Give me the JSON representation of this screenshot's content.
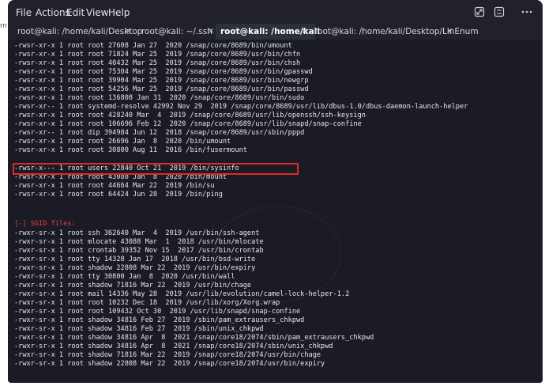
{
  "menubar": {
    "items": [
      "File",
      "Actions",
      "Edit",
      "View",
      "Help"
    ],
    "controls": {
      "maximize": "expand-icon",
      "split": "split-icon",
      "more": "more-icon"
    }
  },
  "tabs": [
    {
      "label": "root@kali: /home/kali/Desktop",
      "close": "×"
    },
    {
      "label": "root@kali: ~/.ssh",
      "close": "×"
    },
    {
      "label": "root@kali: /home/kali",
      "close": "×",
      "active": true
    },
    {
      "label": "root@kali: /home/kali/Desktop/LinEnum",
      "close": "×"
    }
  ],
  "terminal": {
    "suid_lines": [
      "-rwsr-xr-x 1 root root 27608 Jan 27  2020 /snap/core/8689/bin/umount",
      "-rwsr-xr-x 1 root root 71824 Mar 25  2019 /snap/core/8689/usr/bin/chfn",
      "-rwsr-xr-x 1 root root 40432 Mar 25  2019 /snap/core/8689/usr/bin/chsh",
      "-rwsr-xr-x 1 root root 75304 Mar 25  2019 /snap/core/8689/usr/bin/gpasswd",
      "-rwsr-xr-x 1 root root 39904 Mar 25  2019 /snap/core/8689/usr/bin/newgrp",
      "-rwsr-xr-x 1 root root 54256 Mar 25  2019 /snap/core/8689/usr/bin/passwd",
      "-rwsr-xr-x 1 root root 136808 Jan 31  2020 /snap/core/8689/usr/bin/sudo",
      "-rwsr-xr-- 1 root systemd-resolve 42992 Nov 29  2019 /snap/core/8689/usr/lib/dbus-1.0/dbus-daemon-launch-helper",
      "-rwsr-xr-x 1 root root 428240 Mar  4  2019 /snap/core/8689/usr/lib/openssh/ssh-keysign",
      "-rwsr-xr-x 1 root root 106696 Feb 12  2020 /snap/core/8689/usr/lib/snapd/snap-confine",
      "-rwsr-xr-- 1 root dip 394984 Jun 12  2018 /snap/core/8689/usr/sbin/pppd",
      "-rwsr-xr-x 1 root root 26696 Jan  8  2020 /bin/umount",
      "-rwsr-xr-x 1 root root 30800 Aug 11  2016 /bin/fusermount",
      "-rwsr-x--- 1 root users 22840 Oct 21  2019 /bin/sysinfo",
      "-rwsr-xr-x 1 root root 43088 Jan  8  2020 /bin/mount",
      "-rwsr-xr-x 1 root root 44664 Mar 22  2019 /bin/su",
      "-rwsr-xr-x 1 root root 64424 Jun 28  2019 /bin/ping"
    ],
    "sgid_header": "[-] SGID files:",
    "sgid_lines": [
      "-rwxr-sr-x 1 root ssh 362640 Mar  4  2019 /usr/bin/ssh-agent",
      "-rwxr-sr-x 1 root mlocate 43088 Mar  1  2018 /usr/bin/mlocate",
      "-rwxr-sr-x 1 root crontab 39352 Nov 15  2017 /usr/bin/crontab",
      "-rwxr-sr-x 1 root tty 14328 Jan 17  2018 /usr/bin/bsd-write",
      "-rwxr-sr-x 1 root shadow 22808 Mar 22  2019 /usr/bin/expiry",
      "-rwxr-sr-x 1 root tty 30800 Jan  8  2020 /usr/bin/wall",
      "-rwxr-sr-x 1 root shadow 71816 Mar 22  2019 /usr/bin/chage",
      "-rwxr-sr-x 1 root mail 14336 May 28  2019 /usr/lib/evolution/camel-lock-helper-1.2",
      "-rwxr-sr-x 1 root root 10232 Dec 18  2019 /usr/lib/xorg/Xorg.wrap",
      "-rwxr-sr-x 1 root root 109432 Oct 30  2019 /usr/lib/snapd/snap-confine",
      "-rwxr-sr-x 1 root shadow 34816 Feb 27  2019 /sbin/pam_extrausers_chkpwd",
      "-rwxr-sr-x 1 root shadow 34816 Feb 27  2019 /sbin/unix_chkpwd",
      "-rwxr-sr-x 1 root shadow 34816 Apr  8  2021 /snap/core18/2074/sbin/pam_extrausers_chkpwd",
      "-rwxr-sr-x 1 root shadow 34816 Apr  8  2021 /snap/core18/2074/sbin/unix_chkpwd",
      "-rwxr-sr-x 1 root shadow 71816 Mar 22  2019 /snap/core18/2074/usr/bin/chage",
      "-rwxr-sr-x 1 root shadow 22808 Mar 22  2019 /snap/core18/2074/usr/bin/expiry"
    ]
  },
  "colors": {
    "terminal_bg": "#1a1b24",
    "text": "#e7e7e7",
    "section_header": "#e0453f",
    "highlight_box": "#e0282d"
  }
}
